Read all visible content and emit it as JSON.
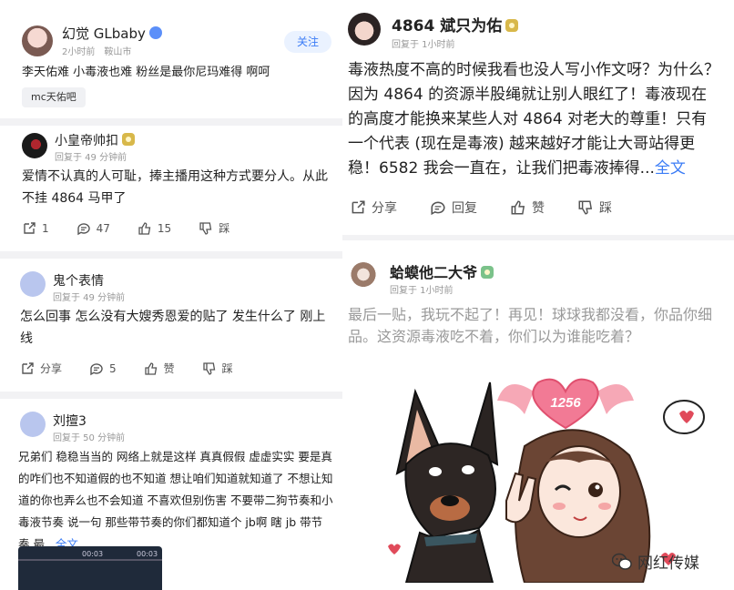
{
  "left": {
    "post": {
      "username": "幻觉 GLbaby",
      "meta": "2小时前　鞍山市",
      "follow_label": "关注",
      "text": "李天佑难 小毒液也难 粉丝是最你尼玛难得 啊呵",
      "tag": "mc天佑吧"
    },
    "comments": [
      {
        "username": "小皇帝帅扣",
        "meta": "回复于 49 分钟前",
        "text": "爱情不认真的人可耻，捧主播用这种方式要分人。从此不挂 4864 马甲了",
        "share": "1",
        "reply": "47",
        "like": "15",
        "dislike": "踩"
      },
      {
        "username": "鬼个表情",
        "meta": "回复于 49 分钟前",
        "text": "怎么回事 怎么没有大嫂秀恩爱的贴了 发生什么了 刚上线",
        "share": "分享",
        "reply": "5",
        "like": "赞",
        "dislike": "踩"
      },
      {
        "username": "刘擅3",
        "meta": "回复于 50 分钟前",
        "text": "兄弟们 稳稳当当的 网络上就是这样 真真假假 虚虚实实 要是真的咋们也不知道假的也不知道 想让咱们知道就知道了 不想让知道的你也弄么也不会知道 不喜欢但别伤害 不要带二狗节奏和小毒液节奏 说一句 那些带节奏的你们都知道个 jb啊 瞎 jb 带节奏 最...",
        "more": "全文",
        "video_time_left": "00:03",
        "video_time_right": "00:03"
      }
    ]
  },
  "right": {
    "comments": [
      {
        "username": "4864 斌只为佑",
        "meta": "回复于 1小时前",
        "text": "毒液热度不高的时候我看也没人写小作文呀？为什么？因为 4864 的资源半股绳就让别人眼红了！毒液现在的高度才能换来某些人对 4864 对老大的尊重！只有一个代表 (现在是毒液) 越来越好才能让大哥站得更稳！6582 我会一直在，让我们把毒液捧得...",
        "more": "全文",
        "share": "分享",
        "reply": "回复",
        "like": "赞",
        "dislike": "踩"
      },
      {
        "username": "蛤蟆他二大爷",
        "meta": "回复于 1小时前",
        "text": "最后一贴，我玩不起了！再见！球球我都没看，你品你细品。这资源毒液吃不着，你们以为谁能吃着？",
        "sticker_number": "1256"
      }
    ],
    "watermark": "网红传媒"
  },
  "colors": {
    "link": "#3b7cf6",
    "meta": "#999999",
    "separator": "#f2f2f4",
    "level_badge": "#d8b84a"
  },
  "icons": [
    "share-icon",
    "reply-icon",
    "like-icon",
    "dislike-icon",
    "verified-icon",
    "level-badge-icon",
    "wechat-icon"
  ]
}
